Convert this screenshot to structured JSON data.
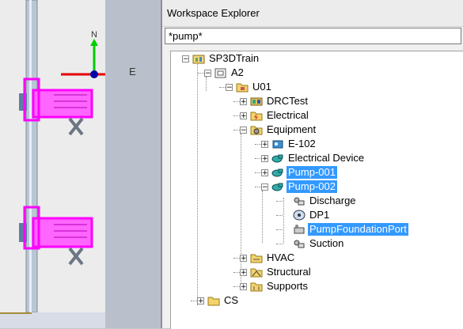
{
  "viewport": {
    "north_label": "N",
    "east_label": "E",
    "colors": {
      "pipe": "#b9c6d4",
      "equipment": "#ff00ff",
      "x_axis": "#e60000",
      "y_axis": "#00cc00",
      "origin": "#0000aa"
    }
  },
  "explorer": {
    "title": "Workspace Explorer",
    "filter": {
      "value": "*pump*"
    },
    "selection_color": "#3399ff",
    "tree": [
      {
        "label": "SP3DTrain",
        "icon": "plant-icon",
        "state": "expanded",
        "selected": false
      },
      {
        "label": "A2",
        "icon": "area-icon",
        "state": "expanded",
        "selected": false
      },
      {
        "label": "U01",
        "icon": "unit-folder-icon",
        "state": "expanded",
        "selected": false
      },
      {
        "label": "DRCTest",
        "icon": "system-icon",
        "state": "collapsed",
        "selected": false
      },
      {
        "label": "Electrical",
        "icon": "electrical-folder-icon",
        "state": "collapsed",
        "selected": false
      },
      {
        "label": "Equipment",
        "icon": "equipment-folder-icon",
        "state": "expanded",
        "selected": false
      },
      {
        "label": "E-102",
        "icon": "equipment-icon",
        "state": "collapsed",
        "selected": false
      },
      {
        "label": "Electrical Device",
        "icon": "pump-icon",
        "state": "collapsed",
        "selected": false
      },
      {
        "label": "Pump-001",
        "icon": "pump-icon",
        "state": "collapsed",
        "selected": true
      },
      {
        "label": "Pump-002",
        "icon": "pump-icon",
        "state": "expanded",
        "selected": true
      },
      {
        "label": "Discharge",
        "icon": "nozzle-icon",
        "state": "leaf",
        "selected": false
      },
      {
        "label": "DP1",
        "icon": "datum-point-icon",
        "state": "leaf",
        "selected": false
      },
      {
        "label": "PumpFoundationPort",
        "icon": "foundation-port-icon",
        "state": "leaf",
        "selected": true
      },
      {
        "label": "Suction",
        "icon": "nozzle-icon",
        "state": "leaf",
        "selected": false
      },
      {
        "label": "HVAC",
        "icon": "hvac-folder-icon",
        "state": "collapsed",
        "selected": false
      },
      {
        "label": "Structural",
        "icon": "structural-folder-icon",
        "state": "collapsed",
        "selected": false
      },
      {
        "label": "Supports",
        "icon": "supports-folder-icon",
        "state": "collapsed",
        "selected": false
      },
      {
        "label": "CS",
        "icon": "folder-icon",
        "state": "collapsed",
        "selected": false
      }
    ]
  }
}
